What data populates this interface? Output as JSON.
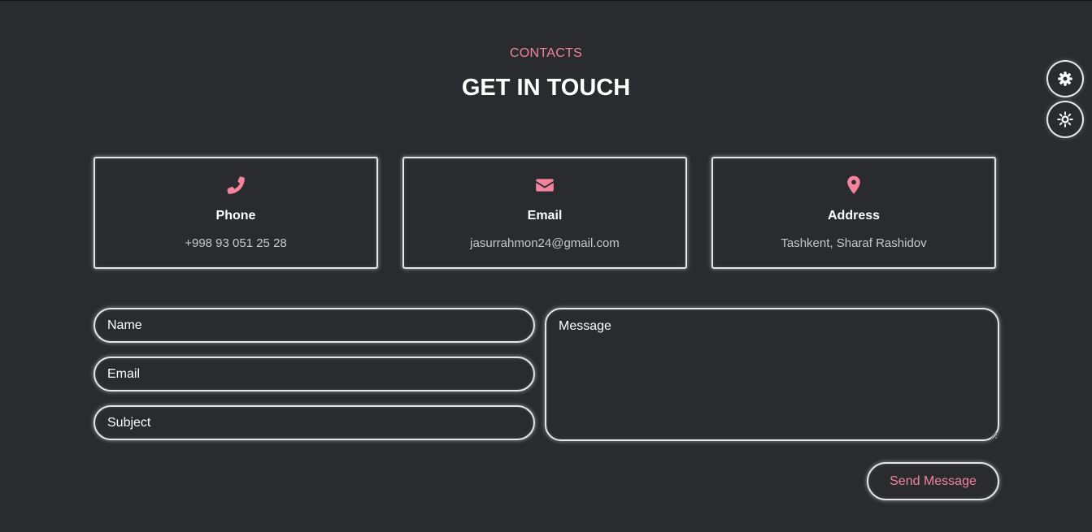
{
  "section": {
    "label": "CONTACTS",
    "title": "GET IN TOUCH"
  },
  "side_buttons": {
    "settings_icon": "gear-icon",
    "theme_icon": "sun-icon"
  },
  "cards": [
    {
      "icon": "phone-icon",
      "title": "Phone",
      "value": "+998 93 051 25 28"
    },
    {
      "icon": "envelope-icon",
      "title": "Email",
      "value": "jasurrahmon24@gmail.com"
    },
    {
      "icon": "map-pin-icon",
      "title": "Address",
      "value": "Tashkent, Sharaf Rashidov"
    }
  ],
  "form": {
    "name_placeholder": "Name",
    "email_placeholder": "Email",
    "subject_placeholder": "Subject",
    "message_placeholder": "Message",
    "send_label": "Send Message"
  },
  "colors": {
    "background": "#2a2b2f",
    "accent": "#f2849e",
    "border": "#e6e6e6",
    "muted_text": "#c9c9cd"
  }
}
